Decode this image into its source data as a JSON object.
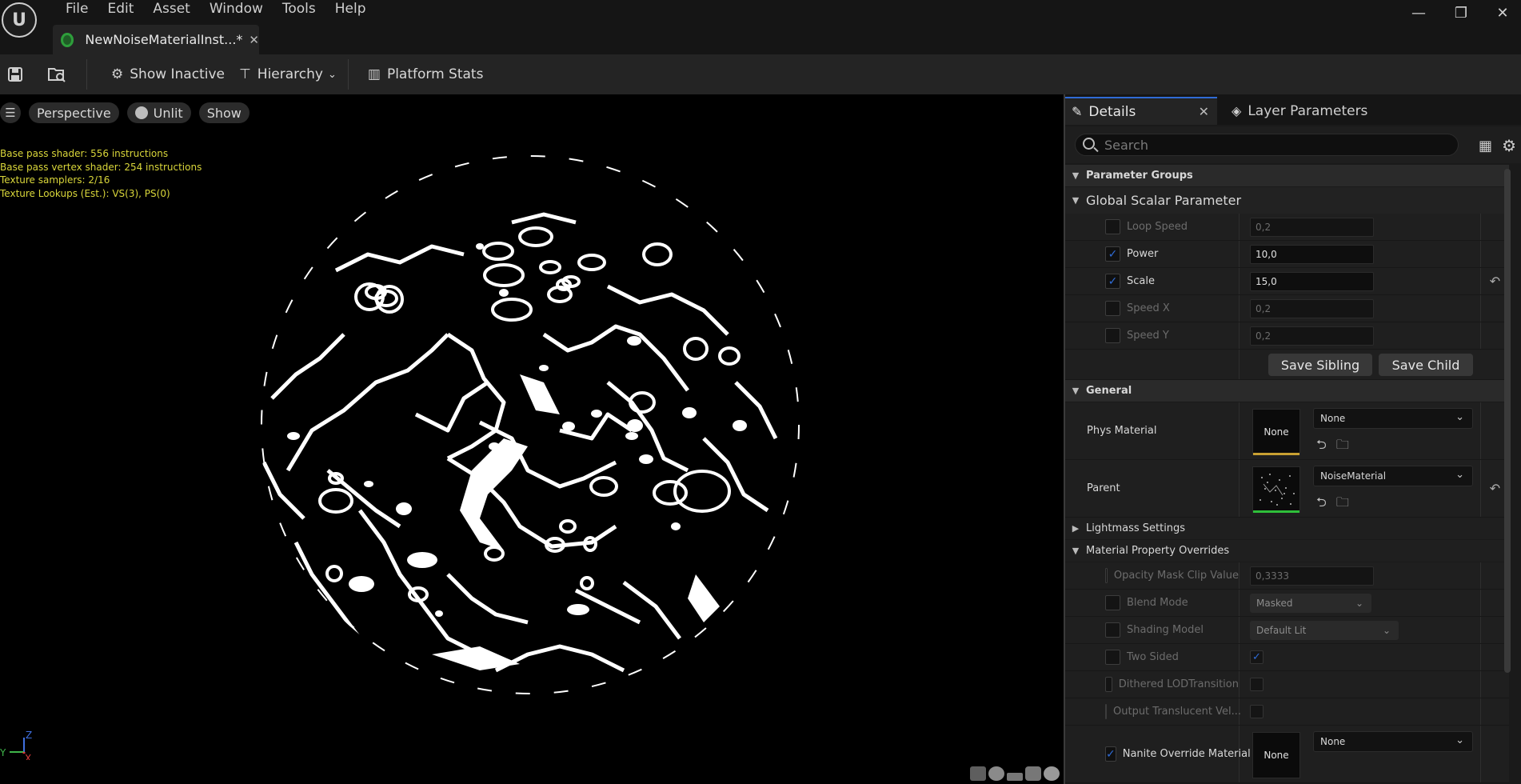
{
  "menu": [
    "File",
    "Edit",
    "Asset",
    "Window",
    "Tools",
    "Help"
  ],
  "asset_tab": {
    "label": "NewNoiseMaterialInst...*",
    "close": "✕"
  },
  "window_controls": {
    "minimize": "—",
    "restore": "❐",
    "close": "✕"
  },
  "toolbar": {
    "show_inactive": "Show Inactive",
    "hierarchy": "Hierarchy",
    "platform_stats": "Platform Stats"
  },
  "viewport": {
    "perspective": "Perspective",
    "unlit": "Unlit",
    "show": "Show",
    "stats": [
      "Base pass shader: 556 instructions",
      "Base pass vertex shader: 254 instructions",
      "Texture samplers: 2/16",
      "Texture Lookups (Est.): VS(3), PS(0)"
    ],
    "axis": {
      "z": "Z",
      "y": "Y",
      "x": "X"
    }
  },
  "details": {
    "tab_details": "Details",
    "tab_layers": "Layer Parameters",
    "search_placeholder": "Search",
    "parameter_groups": "Parameter Groups",
    "global_scalar": "Global Scalar Parameter",
    "scalar_params": [
      {
        "name": "Loop Speed",
        "checked": false,
        "value": "0,2"
      },
      {
        "name": "Power",
        "checked": true,
        "value": "10,0"
      },
      {
        "name": "Scale",
        "checked": true,
        "value": "15,0"
      },
      {
        "name": "Speed X",
        "checked": false,
        "value": "0,2"
      },
      {
        "name": "Speed Y",
        "checked": false,
        "value": "0,2"
      }
    ],
    "save_sibling": "Save Sibling",
    "save_child": "Save Child",
    "general": "General",
    "phys_material": {
      "label": "Phys Material",
      "thumb": "None",
      "value": "None"
    },
    "parent": {
      "label": "Parent",
      "value": "NoiseMaterial"
    },
    "lightmass_settings": "Lightmass Settings",
    "material_property_overrides": "Material Property Overrides",
    "overrides": {
      "opacity_mask": {
        "label": "Opacity Mask Clip Value",
        "value": "0,3333"
      },
      "blend_mode": {
        "label": "Blend Mode",
        "value": "Masked"
      },
      "shading_model": {
        "label": "Shading Model",
        "value": "Default Lit"
      },
      "two_sided": {
        "label": "Two Sided",
        "value": true
      },
      "dithered": {
        "label": "Dithered LODTransition",
        "value": false
      },
      "output_translucent": {
        "label": "Output Translucent Vel...",
        "value": false
      },
      "nanite": {
        "label": "Nanite Override Material",
        "thumb": "None",
        "value": "None"
      }
    }
  },
  "colors": {
    "accent_blue": "#2f6bd6",
    "stats_yellow": "#d9d63a",
    "phys_bar": "#c8a032",
    "parent_bar": "#2fbf3a"
  }
}
